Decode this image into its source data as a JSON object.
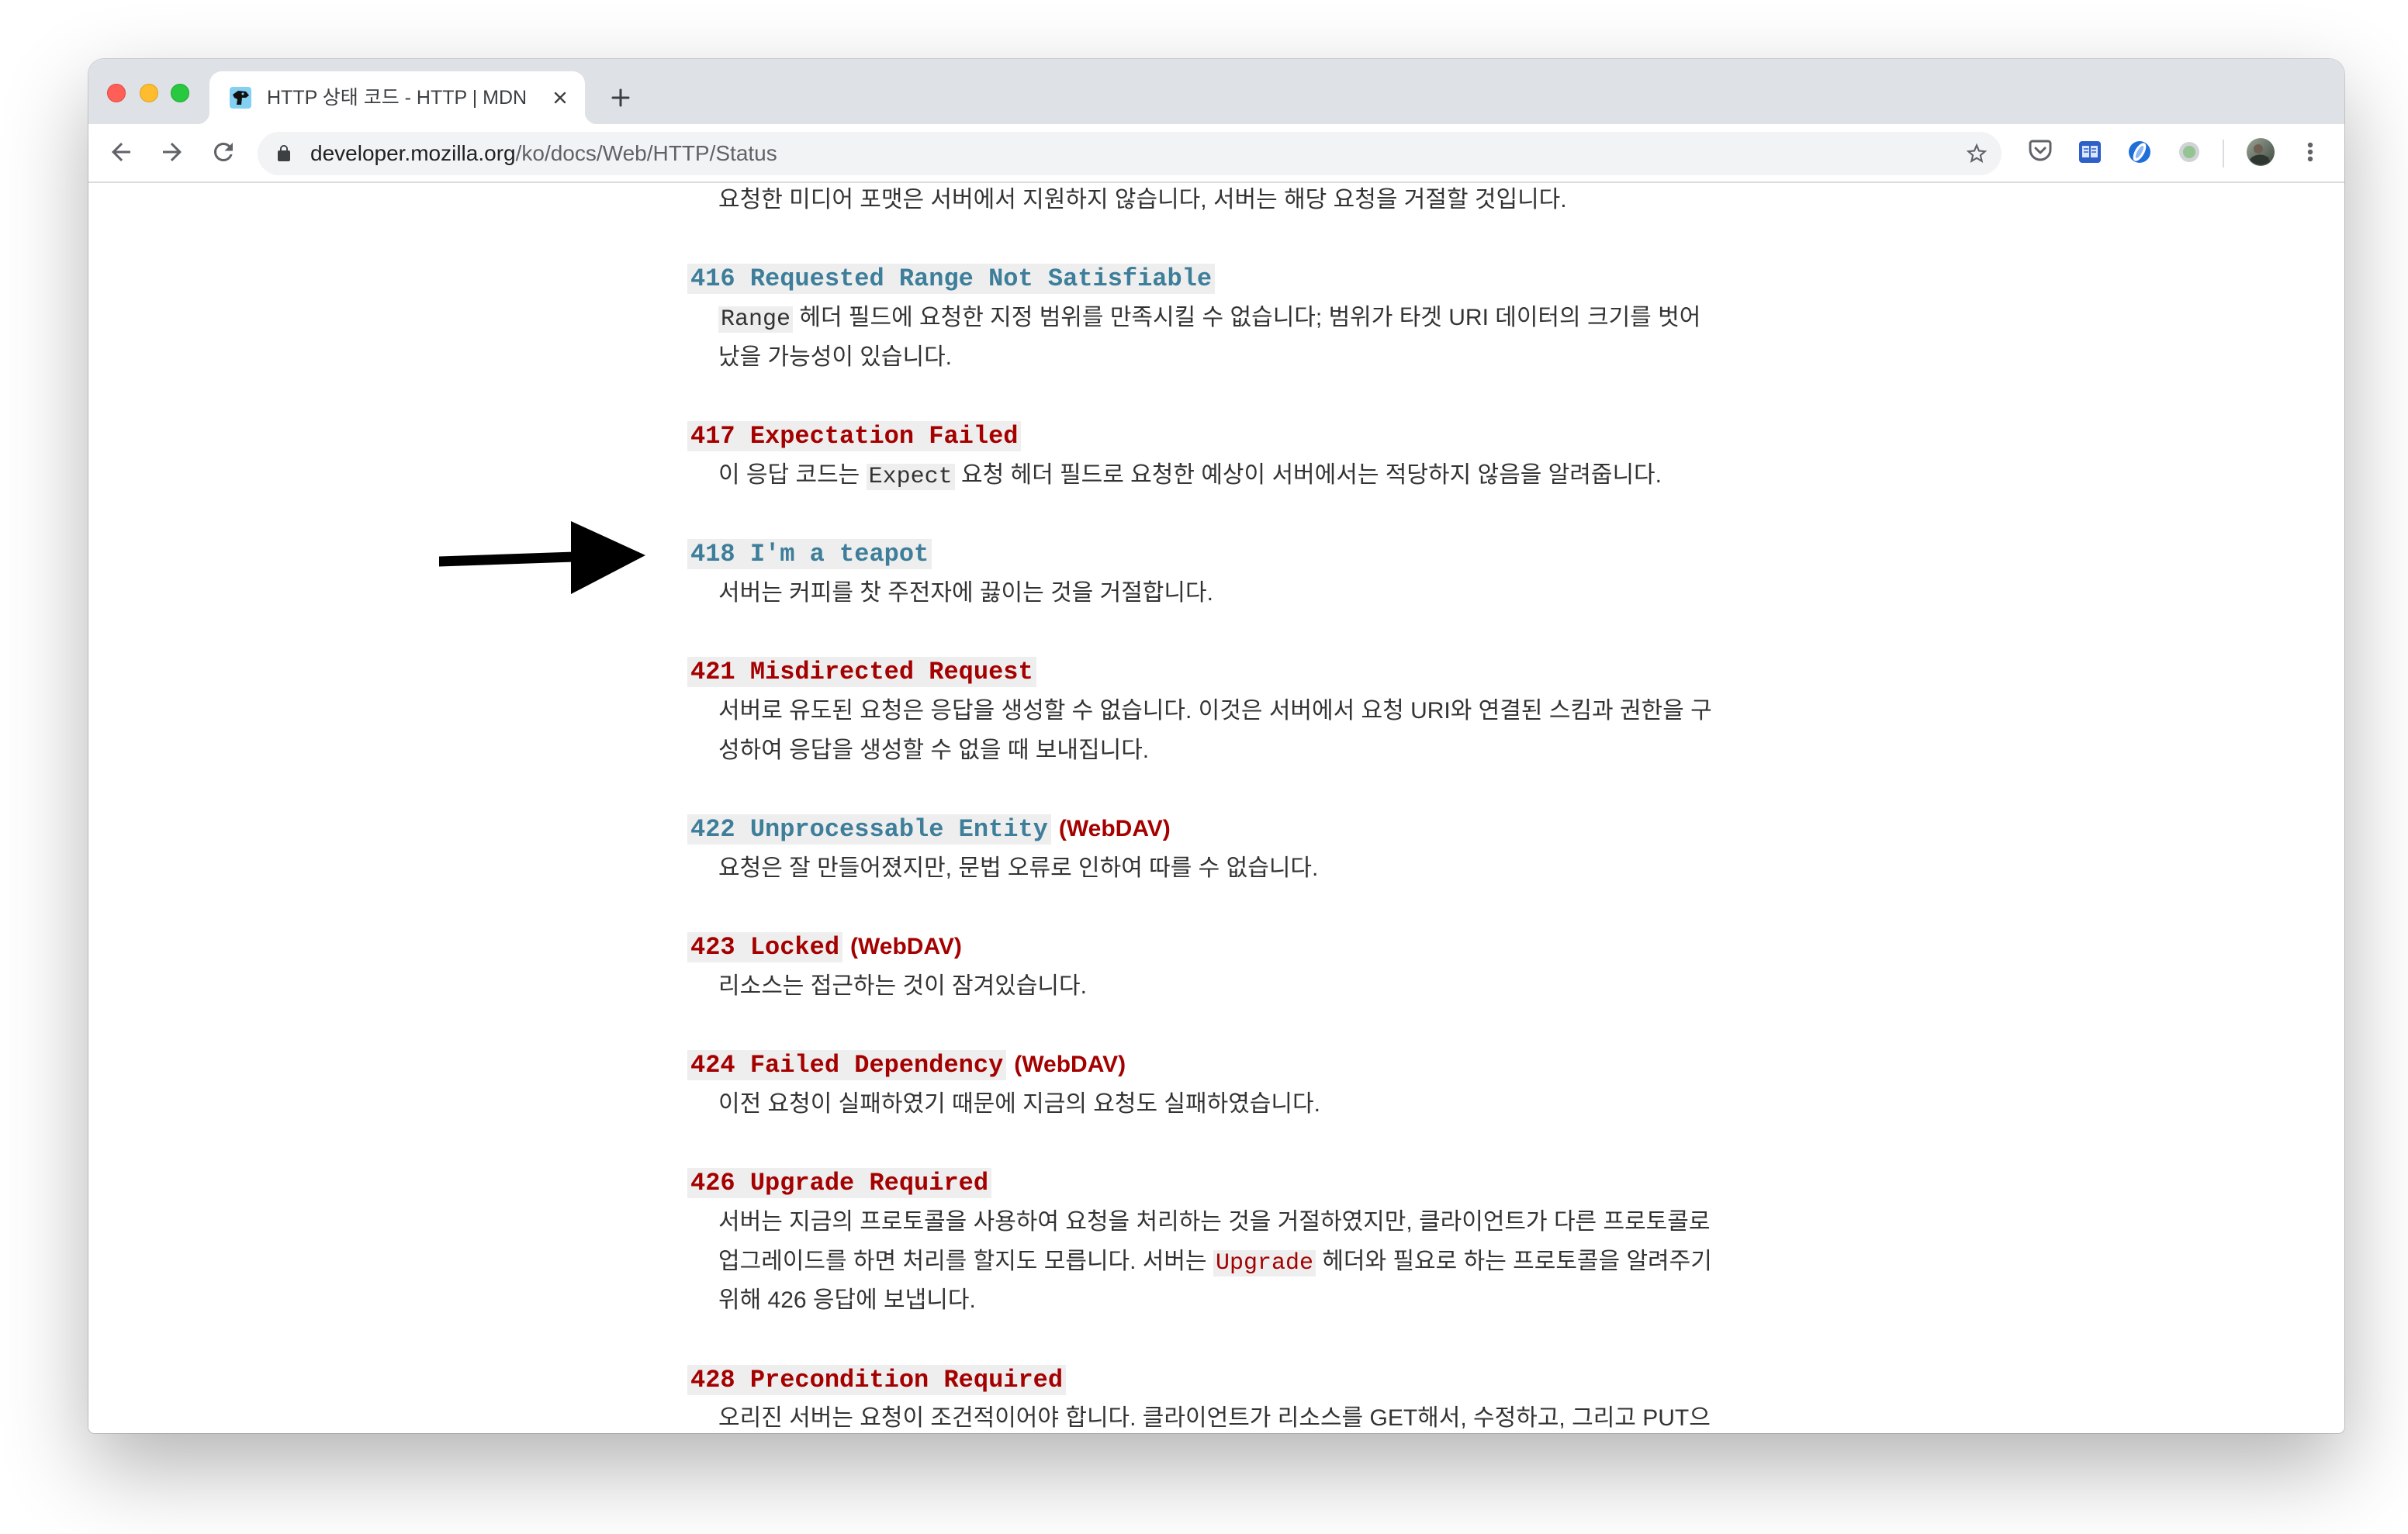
{
  "browser": {
    "tab_title": "HTTP 상태 코드 - HTTP | MDN",
    "url_host": "developer.mozilla.org",
    "url_path": "/ko/docs/Web/HTTP/Status"
  },
  "icons": {
    "window_controls": [
      "close-window-button",
      "minimize-window-button",
      "zoom-window-button"
    ],
    "favicon": "mdn-favicon-icon",
    "tab_close": "close-icon",
    "new_tab": "plus-icon",
    "back": "back-arrow-icon",
    "forward": "forward-arrow-icon",
    "reload": "reload-icon",
    "lock": "lock-icon",
    "bookmark": "star-icon",
    "extensions": [
      "pocket-icon",
      "reading-list-extension-icon",
      "password-manager-extension-icon",
      "status-extension-icon"
    ],
    "profile": "profile-avatar",
    "menu": "kebab-menu-icon",
    "annotation": "arrow-right-icon"
  },
  "colors": {
    "link_existing": "#3d7e9a",
    "link_missing": "#a50000",
    "code_background": "#eeeeee",
    "body_text": "#333333",
    "tab_strip": "#dee1e6",
    "annotation_arrow": "#000000"
  },
  "status_list": [
    {
      "lines": [
        [
          {
            "text": "요청한 미디어 포맷은 서버에서 지원하지 않습니다, 서버는 해당 요청을 거절할 것입니다."
          }
        ]
      ]
    },
    {
      "code": "416 Requested Range Not Satisfiable",
      "color": "#3d7e9a",
      "lines": [
        [
          {
            "code": "Range"
          },
          {
            "text": " 헤더 필드에 요청한 지정 범위를 만족시킬 수 없습니다; 범위가 타겟 URI 데이터의 크기를 벗어"
          }
        ],
        [
          {
            "text": "났을 가능성이 있습니다."
          }
        ]
      ]
    },
    {
      "code": "417 Expectation Failed",
      "color": "#a50000",
      "lines": [
        [
          {
            "text": "이 응답 코드는 "
          },
          {
            "code": "Expect"
          },
          {
            "text": " 요청 헤더 필드로 요청한 예상이 서버에서는 적당하지 않음을 알려줍니다."
          }
        ]
      ]
    },
    {
      "code": "418 I'm a teapot",
      "color": "#3d7e9a",
      "lines": [
        [
          {
            "text": "서버는 커피를 찻 주전자에 끓이는 것을 거절합니다."
          }
        ]
      ]
    },
    {
      "code": "421 Misdirected Request",
      "color": "#a50000",
      "lines": [
        [
          {
            "text": "서버로 유도된 요청은 응답을 생성할 수 없습니다. 이것은 서버에서 요청 URI와 연결된 스킴과 권한을 구"
          }
        ],
        [
          {
            "text": "성하여 응답을 생성할 수 없을 때 보내집니다."
          }
        ]
      ]
    },
    {
      "code": "422 Unprocessable Entity",
      "color": "#3d7e9a",
      "tag": "(WebDAV)",
      "lines": [
        [
          {
            "text": "요청은 잘 만들어졌지만, 문법 오류로 인하여 따를 수 없습니다."
          }
        ]
      ]
    },
    {
      "code": "423 Locked",
      "color": "#a50000",
      "tag": "(WebDAV)",
      "lines": [
        [
          {
            "text": "리소스는 접근하는 것이 잠겨있습니다."
          }
        ]
      ]
    },
    {
      "code": "424 Failed Dependency",
      "color": "#a50000",
      "tag": "(WebDAV)",
      "lines": [
        [
          {
            "text": "이전 요청이 실패하였기 때문에 지금의 요청도 실패하였습니다."
          }
        ]
      ]
    },
    {
      "code": "426 Upgrade Required",
      "color": "#a50000",
      "lines": [
        [
          {
            "text": "서버는 지금의 프로토콜을 사용하여 요청을 처리하는 것을 거절하였지만, 클라이언트가 다른 프로토콜로"
          }
        ],
        [
          {
            "text": "업그레이드를 하면 처리를 할지도 모릅니다. 서버는 "
          },
          {
            "code": "Upgrade",
            "color": "#a50000"
          },
          {
            "text": " 헤더와 필요로 하는 프로토콜을 알려주기"
          }
        ],
        [
          {
            "text": "위해 426 응답에 보냅니다."
          }
        ]
      ]
    },
    {
      "code": "428 Precondition Required",
      "color": "#a50000",
      "lines": [
        [
          {
            "text": "오리진 서버는 요청이 조건적이어야 합니다. 클라이언트가 리소스를 GET해서, 수정하고, 그리고 PUT으"
          }
        ]
      ]
    }
  ]
}
